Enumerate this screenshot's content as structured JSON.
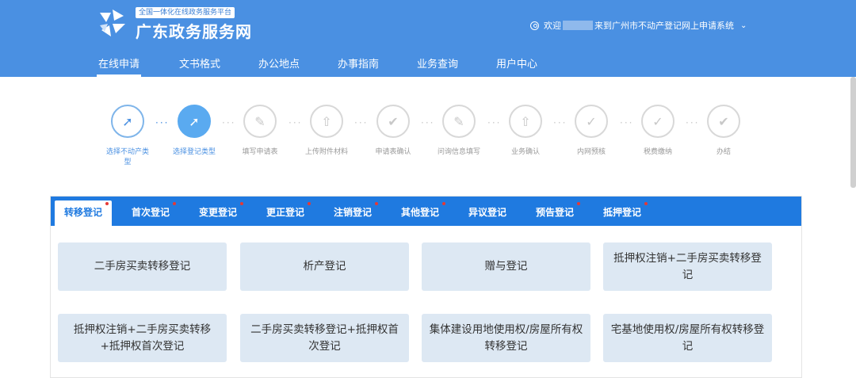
{
  "header": {
    "platform_tag": "全国一体化在线政务服务平台",
    "site_name": "广东政务服务网",
    "welcome_prefix": "欢迎",
    "welcome_suffix": "来到广州市不动产登记网上申请系统",
    "chevron": "⌄"
  },
  "nav": {
    "items": [
      {
        "label": "在线申请"
      },
      {
        "label": "文书格式"
      },
      {
        "label": "办公地点"
      },
      {
        "label": "办事指南"
      },
      {
        "label": "业务查询"
      },
      {
        "label": "用户中心"
      }
    ]
  },
  "steps": [
    {
      "label": "选择不动产类型",
      "icon": "cursor-icon"
    },
    {
      "label": "选择登记类型",
      "icon": "cursor-icon"
    },
    {
      "label": "填写申请表",
      "icon": "pencil-icon"
    },
    {
      "label": "上传附件材料",
      "icon": "upload-icon"
    },
    {
      "label": "申请表确认",
      "icon": "check-hand-icon"
    },
    {
      "label": "问询信息填写",
      "icon": "pencil-icon"
    },
    {
      "label": "业务确认",
      "icon": "upload-icon"
    },
    {
      "label": "内网预核",
      "icon": "check-circle-icon"
    },
    {
      "label": "税费缴纳",
      "icon": "check-circle-icon"
    },
    {
      "label": "办结",
      "icon": "check-hand-icon"
    }
  ],
  "tabs": [
    {
      "label": "转移登记"
    },
    {
      "label": "首次登记"
    },
    {
      "label": "变更登记"
    },
    {
      "label": "更正登记"
    },
    {
      "label": "注销登记"
    },
    {
      "label": "其他登记"
    },
    {
      "label": "异议登记"
    },
    {
      "label": "预告登记"
    },
    {
      "label": "抵押登记"
    }
  ],
  "cards": [
    {
      "label": "二手房买卖转移登记"
    },
    {
      "label": "析产登记"
    },
    {
      "label": "赠与登记"
    },
    {
      "label": "抵押权注销+二手房买卖转移登记"
    },
    {
      "label": "抵押权注销+二手房买卖转移+抵押权首次登记"
    },
    {
      "label": "二手房买卖转移登记+抵押权首次登记"
    },
    {
      "label": "集体建设用地使用权/房屋所有权转移登记"
    },
    {
      "label": "宅基地使用权/房屋所有权转移登记"
    }
  ],
  "colors": {
    "header_bg": "#4a90e2",
    "tabbar_bg": "#1f7ae0",
    "card_bg": "#dde8f3",
    "dot_red": "#e53935"
  }
}
